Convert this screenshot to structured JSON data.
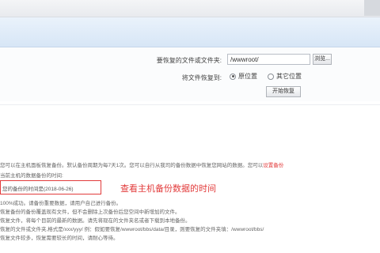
{
  "form": {
    "path_label": "要恢复的文件或文件夹:",
    "path_value": "/wwwroot/",
    "browse_label": "浏览...",
    "restore_label": "将文件恢复到:",
    "radio_options": [
      {
        "label": "原位置",
        "checked": true
      },
      {
        "label": "其它位置",
        "checked": false
      }
    ],
    "start_label": "开始恢复"
  },
  "notes": [
    {
      "text": "您可以在主机面板恢复备份。默认备份周期为每7天1次。您可以自行从我司的备份数据中恢复您网站的数据。您可以",
      "extra": "设置备份"
    },
    {
      "text": "当前主机的数据备份的时间:",
      "extra": ""
    },
    {
      "text": "100%成功。请备份重要数据，请用户自己进行备份。",
      "extra": ""
    },
    {
      "text": "恢复备份的备份覆盖现有文件，但不会删除上次备份后您空间中新增加的文件。",
      "extra": ""
    },
    {
      "text": "恢复文件，将每个目前的最新的数据。请先将现在的文件夹名或者下载到本地备份。",
      "extra": ""
    },
    {
      "text": "恢复的文件或文件夹,格式是/xxx/yyy/ 例：假如要恢复/wwwroot/bbs/data/目录，则要恢复的文件夹填：/wwwroot/bbs/",
      "extra": ""
    },
    {
      "text": "恢复文件较多，恢复需要较长的时间，请耐心等待。",
      "extra": ""
    }
  ],
  "highlight": {
    "text": "您的备份的时间是(2018-06-26)"
  },
  "annotation": "查看主机备份数据的时间",
  "colors": {
    "accent_red": "#e23b3b",
    "header_blue": "#d7e6f6"
  }
}
